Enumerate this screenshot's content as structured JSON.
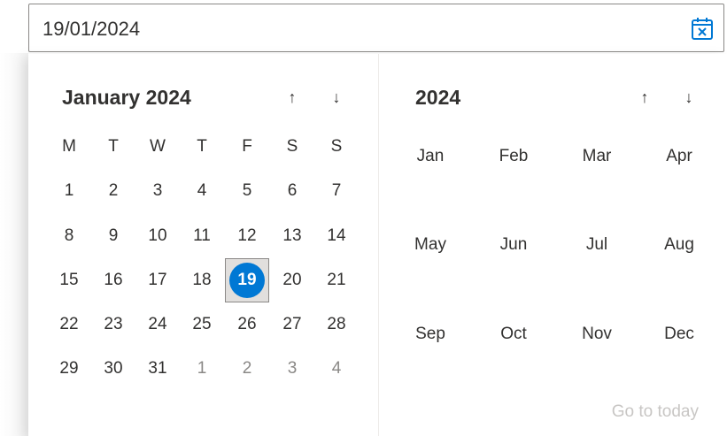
{
  "input": {
    "value": "19/01/2024",
    "icon": "calendar-x-icon"
  },
  "day_picker": {
    "title": "January 2024",
    "weekdays": [
      "M",
      "T",
      "W",
      "T",
      "F",
      "S",
      "S"
    ],
    "weeks": [
      [
        "1",
        "2",
        "3",
        "4",
        "5",
        "6",
        "7"
      ],
      [
        "8",
        "9",
        "10",
        "11",
        "12",
        "13",
        "14"
      ],
      [
        "15",
        "16",
        "17",
        "18",
        "19",
        "20",
        "21"
      ],
      [
        "22",
        "23",
        "24",
        "25",
        "26",
        "27",
        "28"
      ],
      [
        "29",
        "30",
        "31",
        "1",
        "2",
        "3",
        "4"
      ]
    ],
    "selected": "19",
    "prev_icon": "arrow-up-icon",
    "next_icon": "arrow-down-icon"
  },
  "month_picker": {
    "title": "2024",
    "months": [
      "Jan",
      "Feb",
      "Mar",
      "Apr",
      "May",
      "Jun",
      "Jul",
      "Aug",
      "Sep",
      "Oct",
      "Nov",
      "Dec"
    ],
    "prev_icon": "arrow-up-icon",
    "next_icon": "arrow-down-icon",
    "go_to_today": "Go to today"
  },
  "colors": {
    "accent": "#0078d4",
    "text": "#323130",
    "muted": "#8a8886",
    "disabled": "#c8c6c4"
  }
}
